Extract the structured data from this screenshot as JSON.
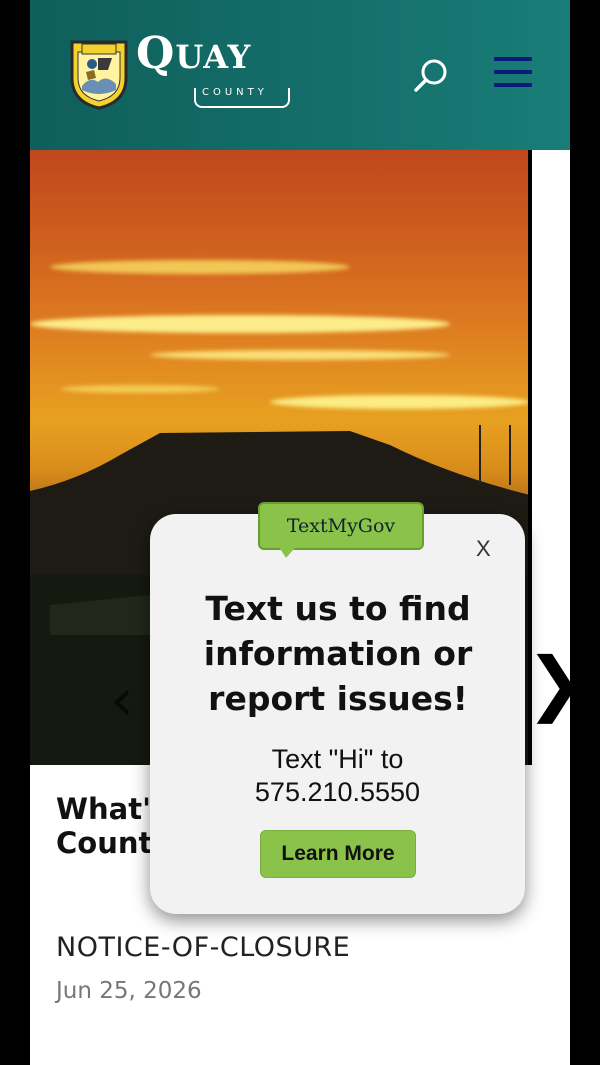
{
  "header": {
    "logo": {
      "wordmark_large": "Q",
      "wordmark_small": "UAY",
      "subline": "COUNTY",
      "shield_text": "QUAY"
    },
    "icons": {
      "search": "search-icon",
      "menu": "hamburger-menu-icon"
    },
    "colors": {
      "header_bg": "#146e6a",
      "menu_icon": "#0a1a7a"
    }
  },
  "slider": {
    "image": "sunset-mesa-landscape",
    "prev_arrow": "‹",
    "next_arrow": "❯"
  },
  "article": {
    "title_line1": "What's Happening in Quay",
    "title_line2": "County",
    "notice": "NOTICE-OF-CLOSURE",
    "date": "Jun 25, 2026"
  },
  "popup": {
    "brand": "TextMyGov",
    "close_label": "X",
    "headline_line1": "Text us to find",
    "headline_line2": "information or",
    "headline_line3": "report issues!",
    "instruction_line1": "Text \"Hi\" to",
    "instruction_line2": "575.210.5550",
    "button_label": "Learn More",
    "colors": {
      "accent": "#8bc34a",
      "background": "#f2f2f2"
    }
  }
}
